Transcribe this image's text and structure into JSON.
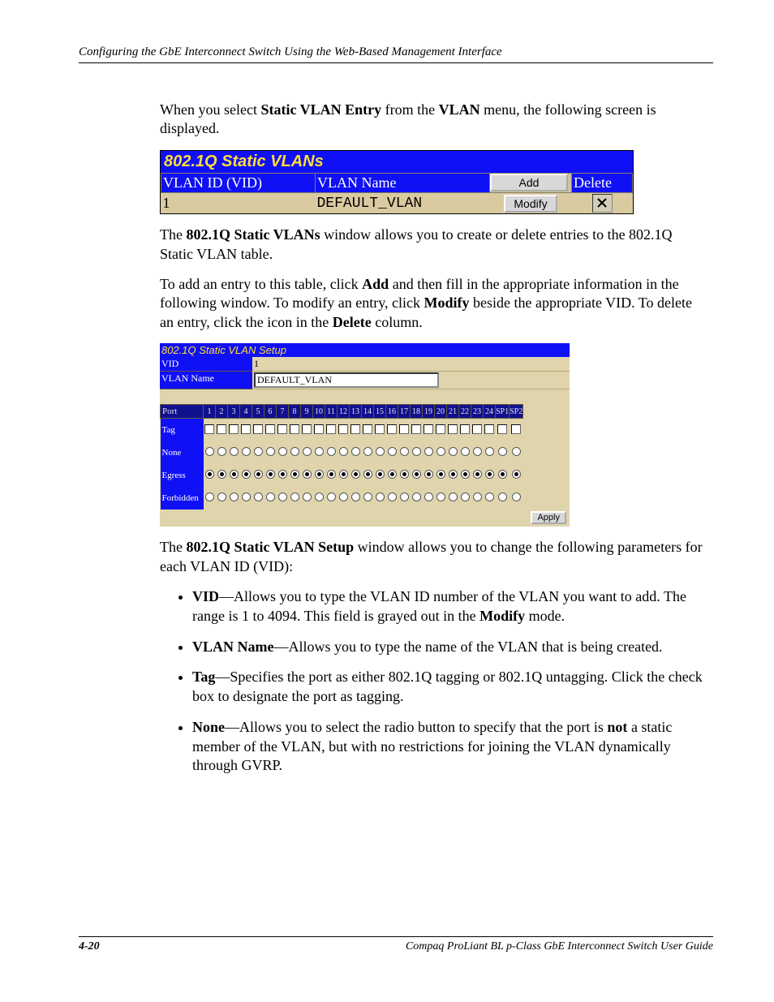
{
  "runningHeader": "Configuring the GbE Interconnect Switch Using the Web-Based Management Interface",
  "intro": {
    "pre": "When you select ",
    "bold1": "Static VLAN Entry",
    "mid1": " from the ",
    "bold2": "VLAN",
    "post": " menu, the following screen is displayed."
  },
  "shot1": {
    "title": "802.1Q Static VLANs",
    "headers": {
      "col1": "VLAN ID (VID)",
      "col2": "VLAN Name",
      "col3": "Add",
      "col4": "Delete"
    },
    "addButton": "Add",
    "row": {
      "id": "1",
      "name": "DEFAULT_VLAN",
      "modify": "Modify"
    }
  },
  "para2": {
    "pre": "The ",
    "bold": "802.1Q Static VLANs",
    "post": " window allows you to create or delete entries to the 802.1Q Static VLAN table."
  },
  "para3": {
    "seg1": "To add an entry to this table, click ",
    "b1": "Add",
    "seg2": " and then fill in the appropriate information in the following window. To modify an entry, click ",
    "b2": "Modify",
    "seg3": " beside the appropriate VID. To delete an entry, click the icon in the ",
    "b3": "Delete",
    "seg4": " column."
  },
  "shot2": {
    "title": "802.1Q Static VLAN Setup",
    "vidLabel": "VID",
    "vidValue": "1",
    "nameLabel": "VLAN Name",
    "nameValue": "DEFAULT_VLAN",
    "ports": [
      "1",
      "2",
      "3",
      "4",
      "5",
      "6",
      "7",
      "8",
      "9",
      "10",
      "11",
      "12",
      "13",
      "14",
      "15",
      "16",
      "17",
      "18",
      "19",
      "20",
      "21",
      "22",
      "23",
      "24",
      "SP1",
      "SP2"
    ],
    "rows": {
      "port": "Port",
      "tag": "Tag",
      "none": "None",
      "egress": "Egress",
      "forbidden": "Forbidden"
    },
    "apply": "Apply"
  },
  "para4": {
    "pre": "The ",
    "bold": "802.1Q Static VLAN Setup",
    "post": " window allows you to change the following parameters for each VLAN ID (VID):"
  },
  "bullets": {
    "b1": {
      "t": "VID",
      "rest1": "—Allows you to type the VLAN ID number of the VLAN you want to add. The range is 1 to 4094. This field is grayed out in the ",
      "b": "Modify",
      "rest2": " mode."
    },
    "b2": {
      "t": "VLAN Name",
      "rest": "—Allows you to type the name of the VLAN that is being created."
    },
    "b3": {
      "t": "Tag",
      "rest": "—Specifies the port as either 802.1Q tagging or 802.1Q untagging. Click the check box to designate the port as tagging."
    },
    "b4": {
      "t": "None",
      "rest1": "—Allows you to select the radio button to specify that the port is ",
      "b": "not",
      "rest2": " a static member of the VLAN, but with no restrictions for joining the VLAN dynamically through GVRP."
    }
  },
  "footer": {
    "page": "4-20",
    "doc": "Compaq ProLiant BL p-Class GbE Interconnect Switch User Guide"
  }
}
